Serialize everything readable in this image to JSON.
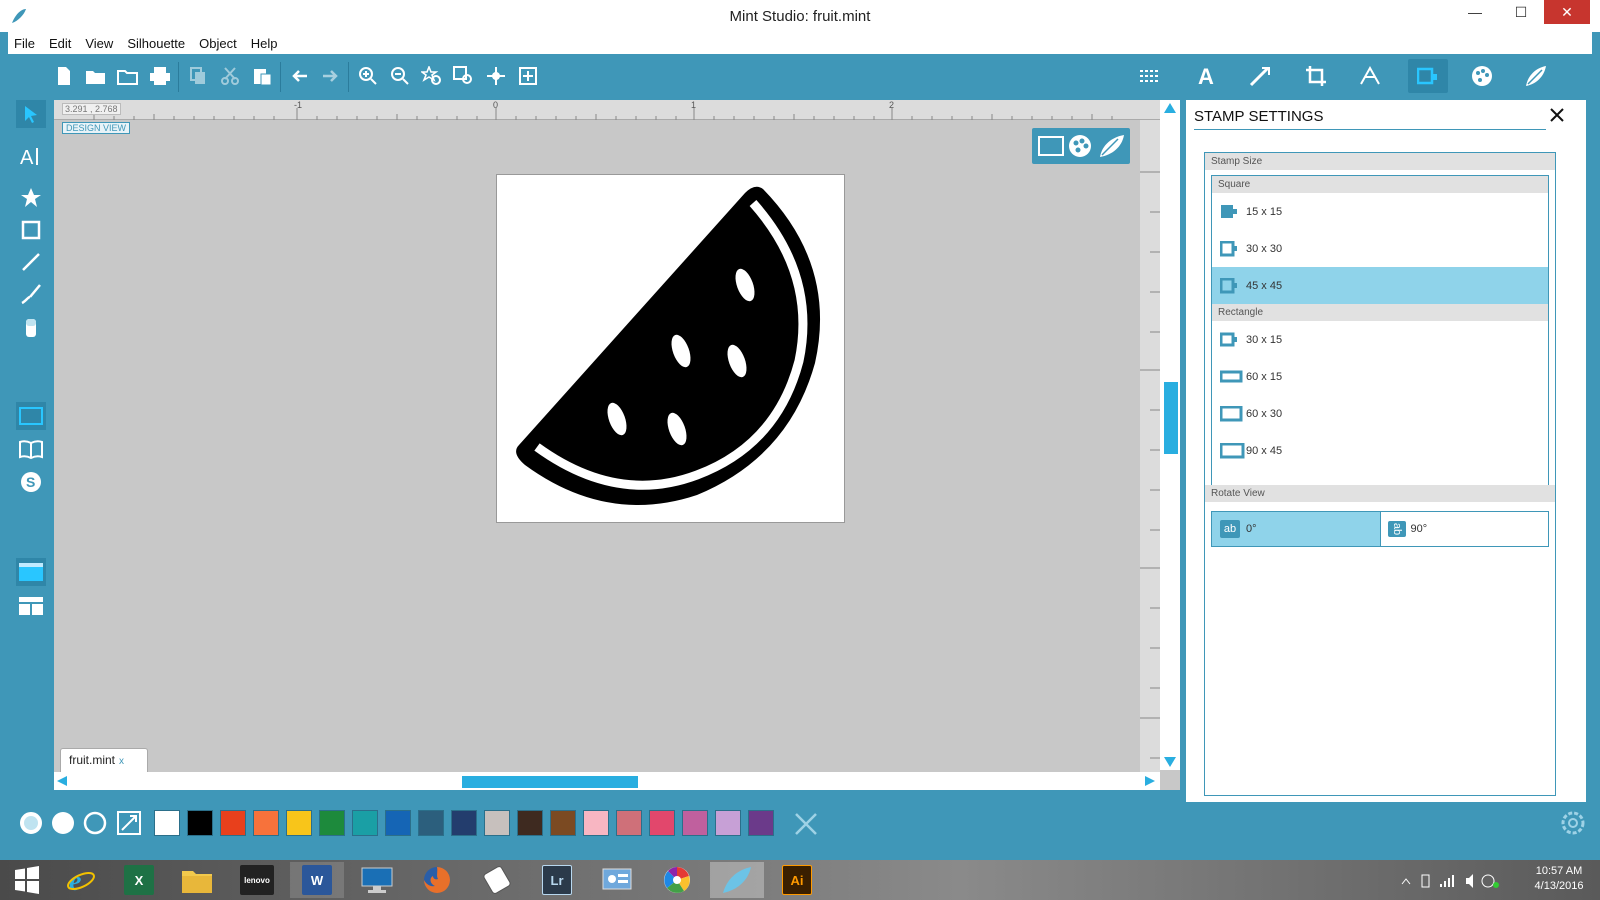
{
  "window": {
    "title": "Mint Studio: fruit.mint",
    "minimize": "—",
    "maximize": "☐",
    "close": "✕"
  },
  "menu": [
    "File",
    "Edit",
    "View",
    "Silhouette",
    "Object",
    "Help"
  ],
  "canvas": {
    "coords": "3.291 , 2.768",
    "design_view": "DESIGN VIEW",
    "ruler_labels": [
      "-1",
      "0",
      "1",
      "2"
    ],
    "doc_tab": "fruit.mint",
    "doc_tab_close": "x"
  },
  "panel": {
    "title": "STAMP SETTINGS",
    "stamp_size_label": "Stamp Size",
    "square_label": "Square",
    "square_options": [
      "15 x 15",
      "30 x 30",
      "45 x 45"
    ],
    "rectangle_label": "Rectangle",
    "rectangle_options": [
      "30 x 15",
      "60 x 15",
      "60 x 30",
      "90 x 45"
    ],
    "selected_option": "45 x 45",
    "rotate_label": "Rotate View",
    "rotate_options": [
      {
        "icon": "ab",
        "label": "0°"
      },
      {
        "icon": "ab",
        "label": "90°"
      }
    ],
    "selected_rotate": "0°"
  },
  "colors": {
    "accent": "#3f97b8",
    "selected": "#8fd3ea",
    "thumb": "#29aee0"
  },
  "palette": [
    "#ffffff",
    "#000000",
    "#e8401c",
    "#f7723b",
    "#f8c51a",
    "#1d8a3c",
    "#1a9fa5",
    "#1565b5",
    "#2c5f7d",
    "#233d6d",
    "#c7c0bd",
    "#3e2a20",
    "#7b4a22",
    "#f8b6c2",
    "#cf7079",
    "#e2476c",
    "#c0609e",
    "#c7a0d6",
    "#6b3a8a"
  ],
  "taskbar": {
    "time": "10:57 AM",
    "date": "4/13/2016",
    "apps": [
      "windows-start",
      "internet-explorer",
      "excel",
      "file-explorer",
      "lenovo-photos",
      "word",
      "lenovo-monitor",
      "firefox",
      "dhzw-tool",
      "lightroom",
      "control-panel",
      "picasa",
      "mint-studio",
      "illustrator"
    ],
    "lr_label": "Lr",
    "ai_label": "Ai",
    "word_label": "W",
    "excel_label": "X",
    "lenovo_label": "lenovo"
  }
}
